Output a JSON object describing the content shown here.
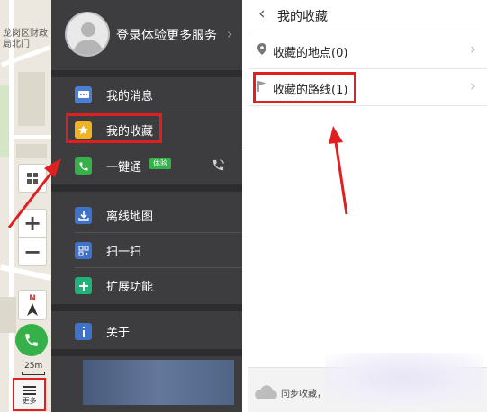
{
  "map": {
    "district_label": "龙岗区财政局北门",
    "zoom_in": "+",
    "zoom_out": "−",
    "compass_n": "N",
    "scale": "25m",
    "more_label": "更多"
  },
  "menu": {
    "login_text": "登录体验更多服务",
    "chevron": "›",
    "items": [
      {
        "label": "我的消息",
        "icon": "message-icon",
        "color": "#4a7fd4"
      },
      {
        "label": "我的收藏",
        "icon": "star-icon",
        "color": "#f0b323"
      },
      {
        "label": "一键通",
        "icon": "phone-icon",
        "color": "#36b14a",
        "badge": "体验"
      },
      {
        "label": "离线地图",
        "icon": "download-icon",
        "color": "#3f72c9"
      },
      {
        "label": "扫一扫",
        "icon": "qrcode-icon",
        "color": "#3f72c9"
      },
      {
        "label": "扩展功能",
        "icon": "plus-icon",
        "color": "#1fb37a"
      },
      {
        "label": "关于",
        "icon": "info-icon",
        "color": "#3f72c9"
      }
    ]
  },
  "favorites": {
    "back": "‹",
    "title": "我的收藏",
    "rows": [
      {
        "label": "收藏的地点(0)",
        "icon": "location-pin-icon"
      },
      {
        "label": "收藏的路线(1)",
        "icon": "route-flag-icon"
      }
    ],
    "chevron": "›",
    "sync_text": "同步收藏，",
    "colors": {
      "highlight": "#e02020",
      "menu_bg": "#3d3d3f"
    }
  }
}
